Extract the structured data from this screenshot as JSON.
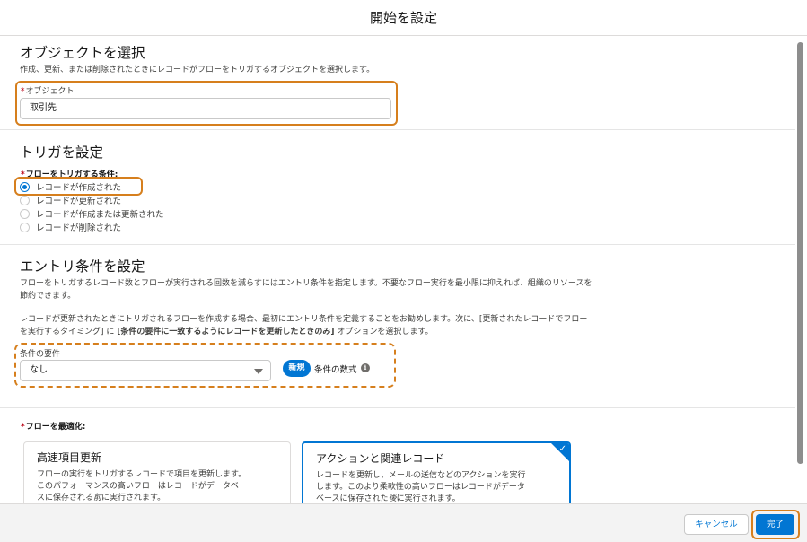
{
  "dialog": {
    "title": "開始を設定"
  },
  "object_section": {
    "title": "オブジェクトを選択",
    "description": "作成、更新、または削除されたときにレコードがフローをトリガするオブジェクトを選択します。",
    "field_required": "*",
    "field_label": "オブジェクト",
    "field_value": "取引先"
  },
  "trigger_section": {
    "title": "トリガを設定",
    "field_required": "*",
    "field_label": "フローをトリガする条件:",
    "options": [
      {
        "label": "レコードが作成された",
        "selected": true
      },
      {
        "label": "レコードが更新された",
        "selected": false
      },
      {
        "label": "レコードが作成または更新された",
        "selected": false
      },
      {
        "label": "レコードが削除された",
        "selected": false
      }
    ]
  },
  "entry_section": {
    "title": "エントリ条件を設定",
    "desc1_line1": "フローをトリガするレコード数とフローが実行される回数を減らすにはエントリ条件を指定します。不要なフロー実行を最小限に抑えれば、組織のリソースを",
    "desc1_line2": "節約できます。",
    "desc2_line1": "レコードが更新されたときにトリガされるフローを作成する場合、最初にエントリ条件を定義することをお勧めします。次に、[更新されたレコードでフロー",
    "desc2_line2_pre": "を実行するタイミング] に ",
    "desc2_line2_bold": "[条件の要件に一致するようにレコードを更新したときのみ]",
    "desc2_line2_post": " オプションを選択します。",
    "requirement_label": "条件の要件",
    "requirement_value": "なし",
    "new_badge": "新規",
    "formula_label": "条件の数式",
    "info_icon": "i"
  },
  "optimize_section": {
    "field_required": "*",
    "field_label": "フローを最適化:",
    "cards": [
      {
        "title": "高速項目更新",
        "desc_line1": "フローの実行をトリガするレコードで項目を更新します。",
        "desc_line2": "このパフォーマンスの高いフローはレコードがデータベー",
        "desc_line3_pre": "スに保存される",
        "desc_line3_em": "前",
        "desc_line3_post": "に実行されます。",
        "selected": false
      },
      {
        "title": "アクションと関連レコード",
        "desc_line1": "レコードを更新し、メールの送信などのアクションを実行",
        "desc_line2": "します。このより柔軟性の高いフローはレコードがデータ",
        "desc_line3_pre": "ベースに保存された",
        "desc_line3_em": "後",
        "desc_line3_post": "に実行されます。",
        "selected": true
      }
    ],
    "check_icon": "✓"
  },
  "footer": {
    "cancel_label": "キャンセル",
    "done_label": "完了"
  },
  "colors": {
    "brand": "#0176d3",
    "highlight": "#d67f1d",
    "required": "#ba0517"
  }
}
